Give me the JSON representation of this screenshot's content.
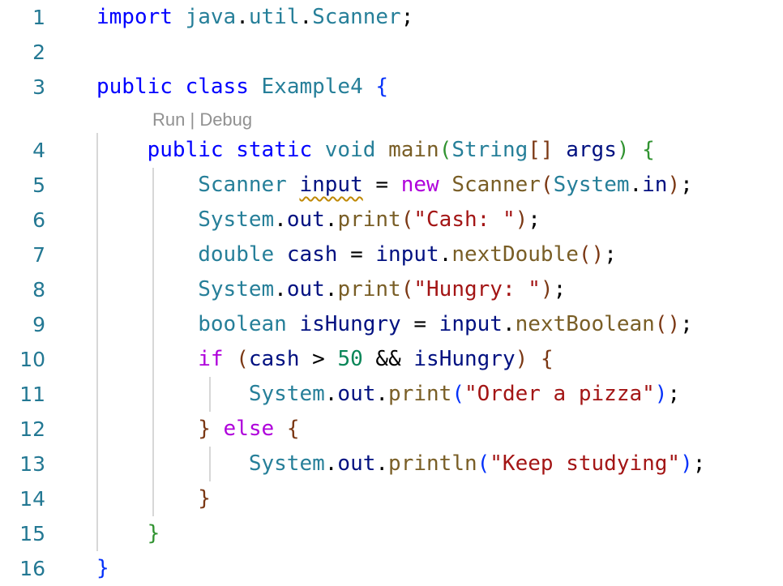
{
  "editor": {
    "codelens": {
      "run_label": "Run",
      "separator": " | ",
      "debug_label": "Debug"
    },
    "lines": [
      {
        "number": "1",
        "tokens": [
          {
            "t": "import",
            "c": "kw"
          },
          {
            "t": " "
          },
          {
            "t": "java",
            "c": "type"
          },
          {
            "t": "."
          },
          {
            "t": "util",
            "c": "type"
          },
          {
            "t": "."
          },
          {
            "t": "Scanner",
            "c": "type"
          },
          {
            "t": ";"
          }
        ]
      },
      {
        "number": "2",
        "tokens": []
      },
      {
        "number": "3",
        "tokens": [
          {
            "t": "public",
            "c": "kw"
          },
          {
            "t": " "
          },
          {
            "t": "class",
            "c": "kw"
          },
          {
            "t": " "
          },
          {
            "t": "Example4",
            "c": "type"
          },
          {
            "t": " "
          },
          {
            "t": "{",
            "c": "b1"
          }
        ]
      },
      {
        "number": "4",
        "tokens": [
          {
            "t": "    "
          },
          {
            "t": "public",
            "c": "kw"
          },
          {
            "t": " "
          },
          {
            "t": "static",
            "c": "kw"
          },
          {
            "t": " "
          },
          {
            "t": "void",
            "c": "type"
          },
          {
            "t": " "
          },
          {
            "t": "main",
            "c": "fn"
          },
          {
            "t": "(",
            "c": "b2"
          },
          {
            "t": "String",
            "c": "type"
          },
          {
            "t": "[]",
            "c": "b3"
          },
          {
            "t": " "
          },
          {
            "t": "args",
            "c": "var"
          },
          {
            "t": ")",
            "c": "b2"
          },
          {
            "t": " "
          },
          {
            "t": "{",
            "c": "b2"
          }
        ]
      },
      {
        "number": "5",
        "tokens": [
          {
            "t": "        "
          },
          {
            "t": "Scanner",
            "c": "type"
          },
          {
            "t": " "
          },
          {
            "t": "input",
            "c": "var",
            "warn": true
          },
          {
            "t": " = "
          },
          {
            "t": "new",
            "c": "ctl"
          },
          {
            "t": " "
          },
          {
            "t": "Scanner",
            "c": "fn"
          },
          {
            "t": "(",
            "c": "b3"
          },
          {
            "t": "System",
            "c": "type"
          },
          {
            "t": "."
          },
          {
            "t": "in",
            "c": "var"
          },
          {
            "t": ")",
            "c": "b3"
          },
          {
            "t": ";"
          }
        ]
      },
      {
        "number": "6",
        "tokens": [
          {
            "t": "        "
          },
          {
            "t": "System",
            "c": "type"
          },
          {
            "t": "."
          },
          {
            "t": "out",
            "c": "var"
          },
          {
            "t": "."
          },
          {
            "t": "print",
            "c": "fn"
          },
          {
            "t": "(",
            "c": "b3"
          },
          {
            "t": "\"Cash: \"",
            "c": "str"
          },
          {
            "t": ")",
            "c": "b3"
          },
          {
            "t": ";"
          }
        ]
      },
      {
        "number": "7",
        "tokens": [
          {
            "t": "        "
          },
          {
            "t": "double",
            "c": "type"
          },
          {
            "t": " "
          },
          {
            "t": "cash",
            "c": "var"
          },
          {
            "t": " = "
          },
          {
            "t": "input",
            "c": "var"
          },
          {
            "t": "."
          },
          {
            "t": "nextDouble",
            "c": "fn"
          },
          {
            "t": "()",
            "c": "b3"
          },
          {
            "t": ";"
          }
        ]
      },
      {
        "number": "8",
        "tokens": [
          {
            "t": "        "
          },
          {
            "t": "System",
            "c": "type"
          },
          {
            "t": "."
          },
          {
            "t": "out",
            "c": "var"
          },
          {
            "t": "."
          },
          {
            "t": "print",
            "c": "fn"
          },
          {
            "t": "(",
            "c": "b3"
          },
          {
            "t": "\"Hungry: \"",
            "c": "str"
          },
          {
            "t": ")",
            "c": "b3"
          },
          {
            "t": ";"
          }
        ]
      },
      {
        "number": "9",
        "tokens": [
          {
            "t": "        "
          },
          {
            "t": "boolean",
            "c": "type"
          },
          {
            "t": " "
          },
          {
            "t": "isHungry",
            "c": "var"
          },
          {
            "t": " = "
          },
          {
            "t": "input",
            "c": "var"
          },
          {
            "t": "."
          },
          {
            "t": "nextBoolean",
            "c": "fn"
          },
          {
            "t": "()",
            "c": "b3"
          },
          {
            "t": ";"
          }
        ]
      },
      {
        "number": "10",
        "tokens": [
          {
            "t": "        "
          },
          {
            "t": "if",
            "c": "ctl"
          },
          {
            "t": " "
          },
          {
            "t": "(",
            "c": "b3"
          },
          {
            "t": "cash",
            "c": "var"
          },
          {
            "t": " > "
          },
          {
            "t": "50",
            "c": "num"
          },
          {
            "t": " && "
          },
          {
            "t": "isHungry",
            "c": "var"
          },
          {
            "t": ")",
            "c": "b3"
          },
          {
            "t": " "
          },
          {
            "t": "{",
            "c": "b3"
          }
        ]
      },
      {
        "number": "11",
        "tokens": [
          {
            "t": "            "
          },
          {
            "t": "System",
            "c": "type"
          },
          {
            "t": "."
          },
          {
            "t": "out",
            "c": "var"
          },
          {
            "t": "."
          },
          {
            "t": "print",
            "c": "fn"
          },
          {
            "t": "(",
            "c": "b1"
          },
          {
            "t": "\"Order a pizza\"",
            "c": "str"
          },
          {
            "t": ")",
            "c": "b1"
          },
          {
            "t": ";"
          }
        ]
      },
      {
        "number": "12",
        "tokens": [
          {
            "t": "        "
          },
          {
            "t": "}",
            "c": "b3"
          },
          {
            "t": " "
          },
          {
            "t": "else",
            "c": "ctl"
          },
          {
            "t": " "
          },
          {
            "t": "{",
            "c": "b3"
          }
        ]
      },
      {
        "number": "13",
        "tokens": [
          {
            "t": "            "
          },
          {
            "t": "System",
            "c": "type"
          },
          {
            "t": "."
          },
          {
            "t": "out",
            "c": "var"
          },
          {
            "t": "."
          },
          {
            "t": "println",
            "c": "fn"
          },
          {
            "t": "(",
            "c": "b1"
          },
          {
            "t": "\"Keep studying\"",
            "c": "str"
          },
          {
            "t": ")",
            "c": "b1"
          },
          {
            "t": ";"
          }
        ]
      },
      {
        "number": "14",
        "tokens": [
          {
            "t": "        "
          },
          {
            "t": "}",
            "c": "b3"
          }
        ]
      },
      {
        "number": "15",
        "tokens": [
          {
            "t": "    "
          },
          {
            "t": "}",
            "c": "b2"
          }
        ]
      },
      {
        "number": "16",
        "tokens": [
          {
            "t": "}",
            "c": "b1"
          }
        ]
      }
    ]
  },
  "colors": {
    "line_number": "#237893",
    "keyword": "#0000ff",
    "control": "#af00db",
    "type": "#267f99",
    "variable": "#001080",
    "function": "#795e26",
    "string": "#a31515",
    "number": "#098658",
    "bracket_1": "#0431fa",
    "bracket_2": "#319331",
    "bracket_3": "#7b3814",
    "codelens": "#919191",
    "warning_squiggle": "#bf8803"
  }
}
